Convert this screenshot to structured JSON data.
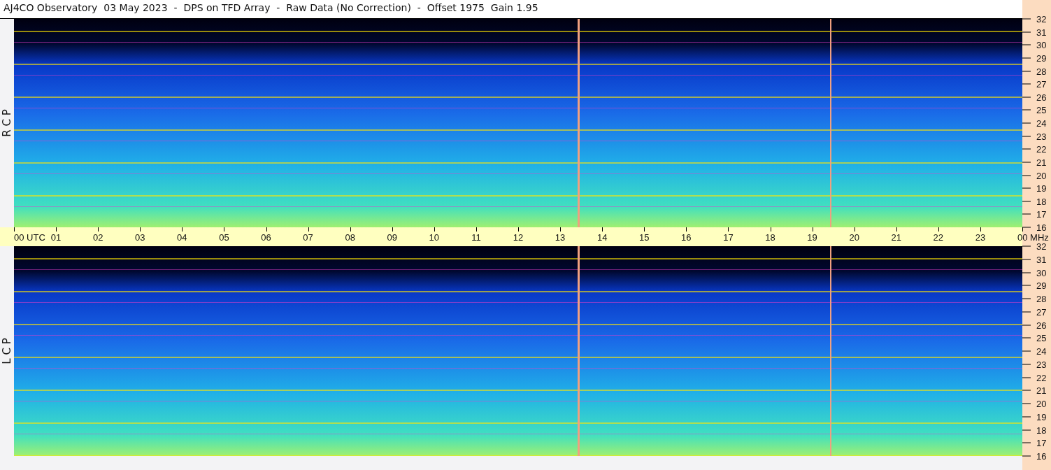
{
  "title": "AJ4CO Observatory  03 May 2023  -  DPS on TFD Array  -  Raw Data (No Correction)  -  Offset 1975  Gain 1.95",
  "panels": [
    {
      "label": "R C P",
      "frequency_labels": [
        "32",
        "31",
        "30",
        "29",
        "28",
        "27",
        "26",
        "25",
        "24",
        "23",
        "22",
        "21",
        "20",
        "19",
        "18",
        "17",
        "16"
      ]
    },
    {
      "label": "L C P",
      "frequency_labels": [
        "32",
        "31",
        "30",
        "29",
        "28",
        "27",
        "26",
        "25",
        "24",
        "23",
        "22",
        "21",
        "20",
        "19",
        "18",
        "17",
        "16"
      ]
    }
  ],
  "time_axis": {
    "labels": [
      "00 UTC",
      "01",
      "02",
      "03",
      "04",
      "05",
      "06",
      "07",
      "08",
      "09",
      "10",
      "11",
      "12",
      "13",
      "14",
      "15",
      "16",
      "17",
      "18",
      "19",
      "20",
      "21",
      "22",
      "23",
      "00 MHz"
    ]
  }
}
